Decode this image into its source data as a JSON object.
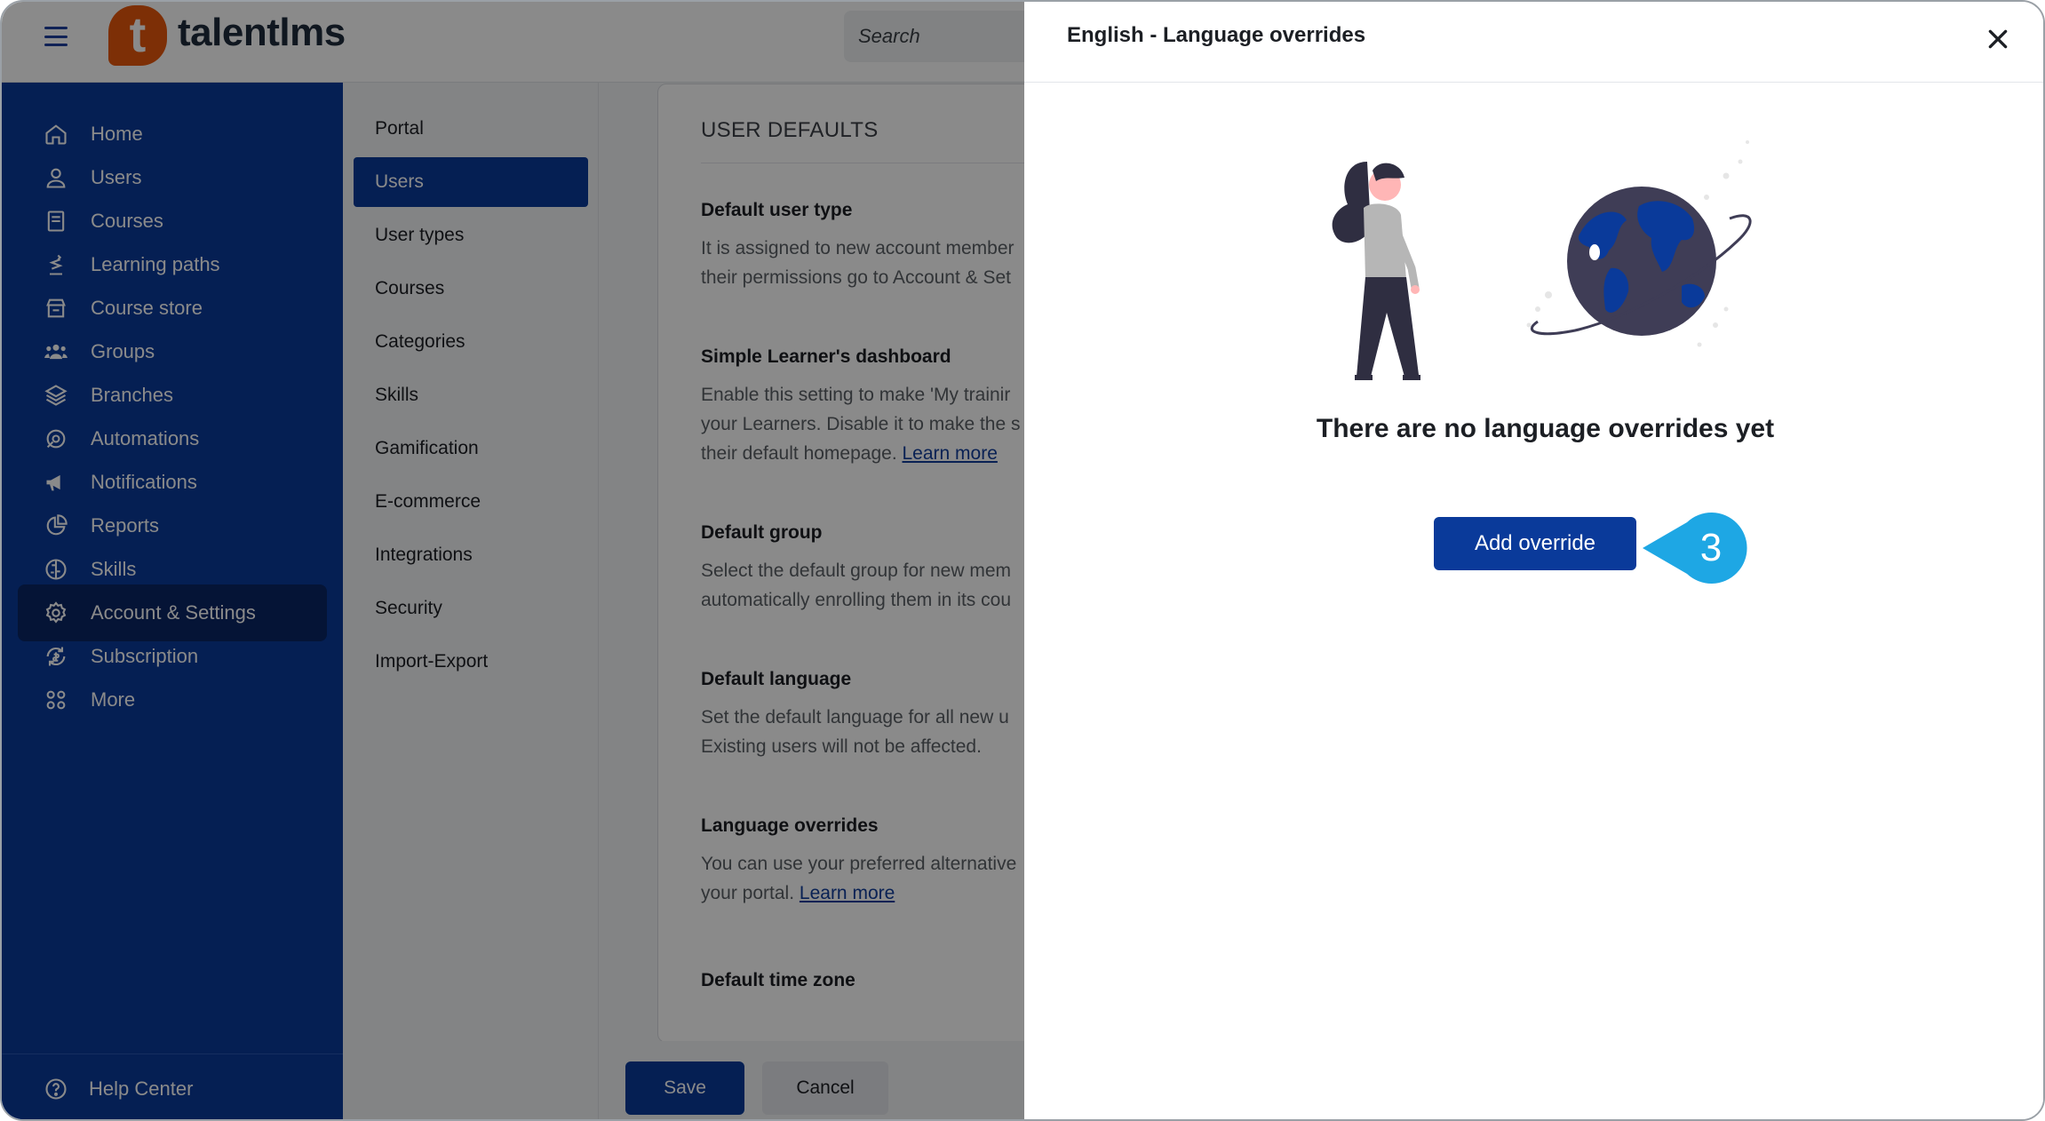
{
  "brand": {
    "logo_letter": "t",
    "name": "talentlms",
    "accent": "#e8580c",
    "sidebar_color": "#0a3a9a"
  },
  "search": {
    "placeholder": "Search"
  },
  "sidebar": {
    "items": [
      {
        "label": "Home",
        "icon": "home-icon"
      },
      {
        "label": "Users",
        "icon": "user-icon"
      },
      {
        "label": "Courses",
        "icon": "book-icon"
      },
      {
        "label": "Learning paths",
        "icon": "path-icon"
      },
      {
        "label": "Course store",
        "icon": "store-icon"
      },
      {
        "label": "Groups",
        "icon": "group-icon"
      },
      {
        "label": "Branches",
        "icon": "layers-icon"
      },
      {
        "label": "Automations",
        "icon": "automation-icon"
      },
      {
        "label": "Notifications",
        "icon": "megaphone-icon"
      },
      {
        "label": "Reports",
        "icon": "pie-chart-icon"
      },
      {
        "label": "Skills",
        "icon": "brain-icon"
      },
      {
        "label": "Account & Settings",
        "icon": "gear-icon",
        "active": true
      },
      {
        "label": "Subscription",
        "icon": "subscription-icon"
      },
      {
        "label": "More",
        "icon": "grid-icon"
      }
    ],
    "help": "Help Center"
  },
  "submenu": {
    "items": [
      "Portal",
      "Users",
      "User types",
      "Courses",
      "Categories",
      "Skills",
      "Gamification",
      "E-commerce",
      "Integrations",
      "Security",
      "Import-Export"
    ],
    "active": "Users"
  },
  "card": {
    "title": "USER DEFAULTS",
    "settings": [
      {
        "title": "Default user type",
        "line1": "It is assigned to new account member",
        "line2": "their permissions go to Account & Set"
      },
      {
        "title": "Simple Learner's dashboard",
        "line1": "Enable this setting to make 'My trainir",
        "line2": "your Learners. Disable it to make the s",
        "line3": "their default homepage.",
        "link": "Learn more"
      },
      {
        "title": "Default group",
        "line1": "Select the default group for new mem",
        "line2": "automatically enrolling them in its cou"
      },
      {
        "title": "Default language",
        "line1": "Set the default language for all new u",
        "line2": "Existing users will not be affected."
      },
      {
        "title": "Language overrides",
        "line1": "You can use your preferred alternative",
        "line2": "your portal.",
        "link": "Learn more"
      },
      {
        "title": "Default time zone"
      }
    ]
  },
  "footer": {
    "save": "Save",
    "cancel": "Cancel"
  },
  "drawer": {
    "title": "English - Language overrides",
    "empty_message": "There are no language overrides yet",
    "add_button": "Add override",
    "step_number": "3",
    "step_color": "#1ea7e4"
  }
}
